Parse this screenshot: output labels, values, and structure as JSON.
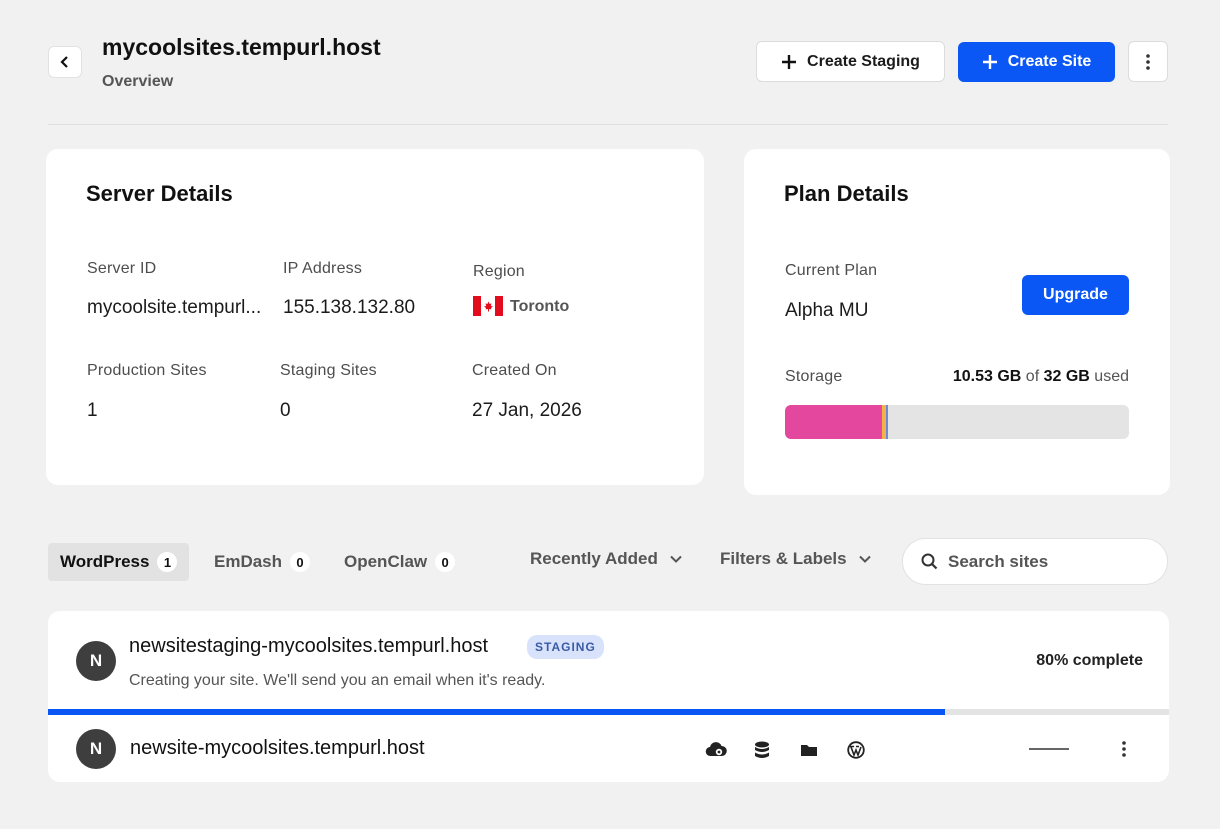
{
  "header": {
    "title": "mycoolsites.tempurl.host",
    "subtitle": "Overview",
    "create_staging_label": "Create Staging",
    "create_site_label": "Create Site"
  },
  "server_details": {
    "title": "Server Details",
    "server_id_label": "Server ID",
    "server_id_value": "mycoolsite.tempurl...",
    "ip_label": "IP Address",
    "ip_value": "155.138.132.80",
    "region_label": "Region",
    "region_value": "Toronto",
    "production_label": "Production Sites",
    "production_value": "1",
    "staging_label": "Staging Sites",
    "staging_value": "0",
    "created_label": "Created On",
    "created_value": "27 Jan, 2026"
  },
  "plan_details": {
    "title": "Plan Details",
    "current_plan_label": "Current Plan",
    "current_plan_value": "Alpha MU",
    "upgrade_label": "Upgrade",
    "storage_label": "Storage",
    "storage_used": "10.53 GB",
    "storage_of": "of",
    "storage_total": "32 GB",
    "storage_suffix": "used",
    "storage_segments": [
      {
        "fraction": 0.282,
        "color": "#e3479e"
      },
      {
        "fraction": 0.012,
        "color": "#f4b14a"
      },
      {
        "fraction": 0.006,
        "color": "#6d8bd4"
      }
    ]
  },
  "tabs": [
    {
      "label": "WordPress",
      "count": "1"
    },
    {
      "label": "EmDash",
      "count": "0"
    },
    {
      "label": "OpenClaw",
      "count": "0"
    }
  ],
  "sort_label": "Recently Added",
  "filters_label": "Filters & Labels",
  "search": {
    "placeholder": "Search sites"
  },
  "sites": [
    {
      "avatar": "N",
      "name": "newsitestaging-mycoolsites.tempurl.host",
      "badge": "STAGING",
      "status": "Creating your site. We'll send you an email when it's ready.",
      "progress_text": "80% complete",
      "progress": 0.8
    },
    {
      "avatar": "N",
      "name": "newsite-mycoolsites.tempurl.host",
      "icons": [
        "cloud-settings-icon",
        "database-icon",
        "folder-icon",
        "wordpress-icon"
      ]
    }
  ],
  "colors": {
    "primary": "#0b57f5",
    "storage_primary": "#e3479e"
  }
}
